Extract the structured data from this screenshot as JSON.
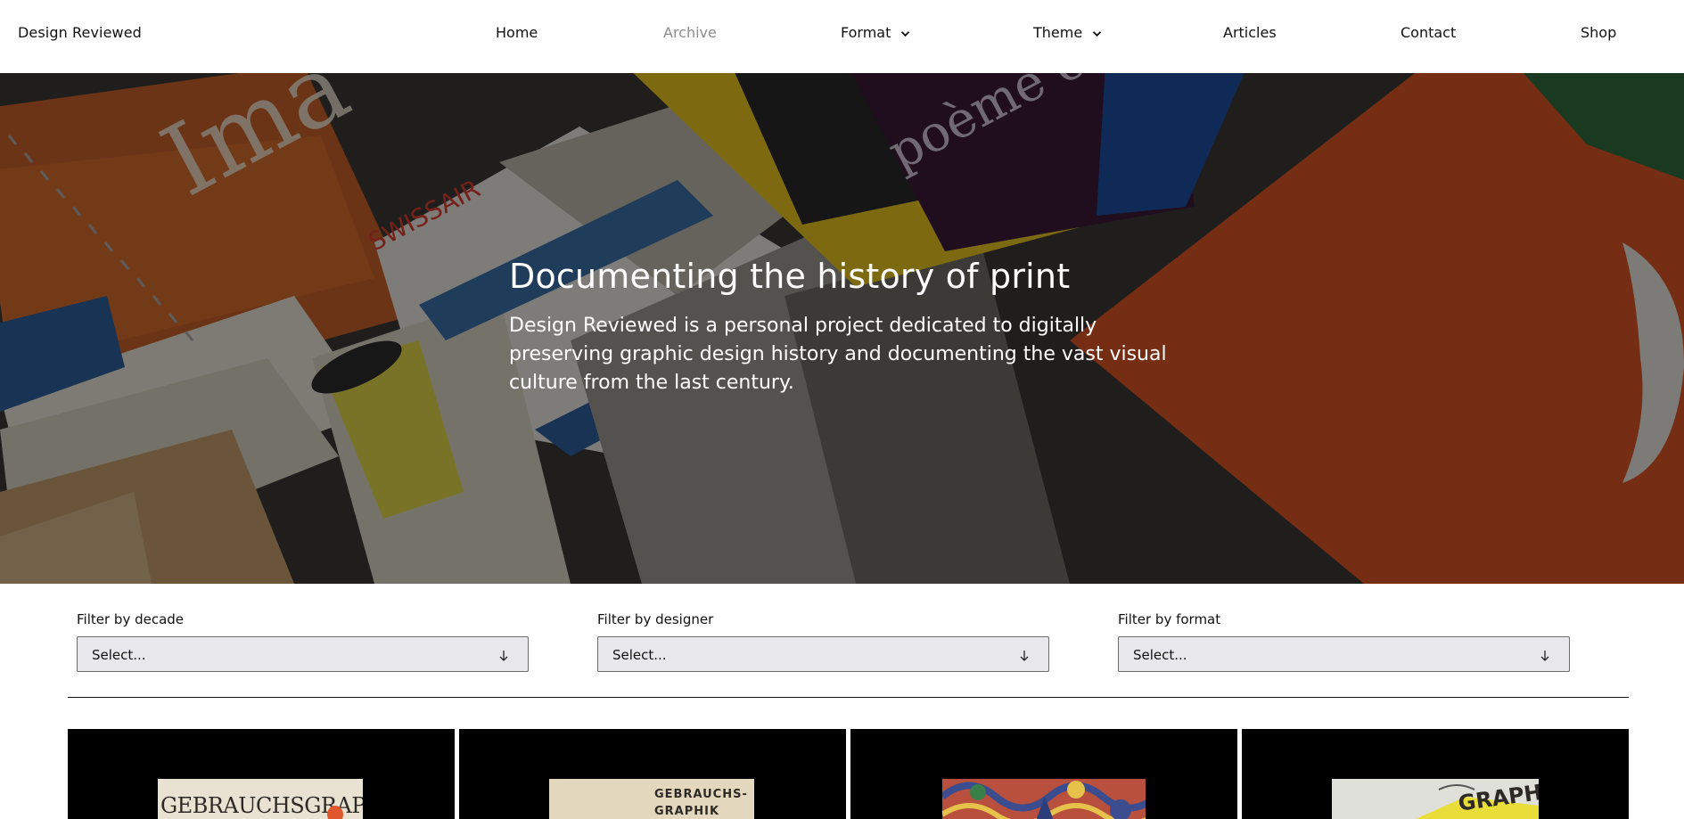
{
  "header": {
    "brand": "Design Reviewed",
    "nav": [
      {
        "label": "Home",
        "dropdown": false,
        "active": false
      },
      {
        "label": "Archive",
        "dropdown": false,
        "active": true
      },
      {
        "label": "Format",
        "dropdown": true,
        "active": false
      },
      {
        "label": "Theme",
        "dropdown": true,
        "active": false
      },
      {
        "label": "Articles",
        "dropdown": false,
        "active": false
      },
      {
        "label": "Contact",
        "dropdown": false,
        "active": false
      },
      {
        "label": "Shop",
        "dropdown": false,
        "active": false
      }
    ]
  },
  "hero": {
    "title": "Documenting the history of print",
    "subtitle": "Design Reviewed is a personal project dedicated to digitally preserving graphic design history and documenting the vast visual culture from the last century."
  },
  "filters": [
    {
      "label": "Filter by decade",
      "value": "Select..."
    },
    {
      "label": "Filter by designer",
      "value": "Select..."
    },
    {
      "label": "Filter by format",
      "value": "Select..."
    }
  ],
  "cards": [
    {
      "cover_text": "GEBRAUCHSGRAPHIK",
      "cover_color": "#e9e2d2"
    },
    {
      "cover_text": "GEBRAUCHS-",
      "cover_text_2": "GRAPHIK",
      "cover_color": "#e3d7bd"
    },
    {
      "cover_text": "",
      "cover_color": "#c0533d"
    },
    {
      "cover_text": "GRAPHIK",
      "cover_color": "#dfe0da"
    }
  ],
  "colors": {
    "nav_muted": "#8c8c8c",
    "select_bg": "#e8e8ec",
    "card_bg": "#000000"
  }
}
